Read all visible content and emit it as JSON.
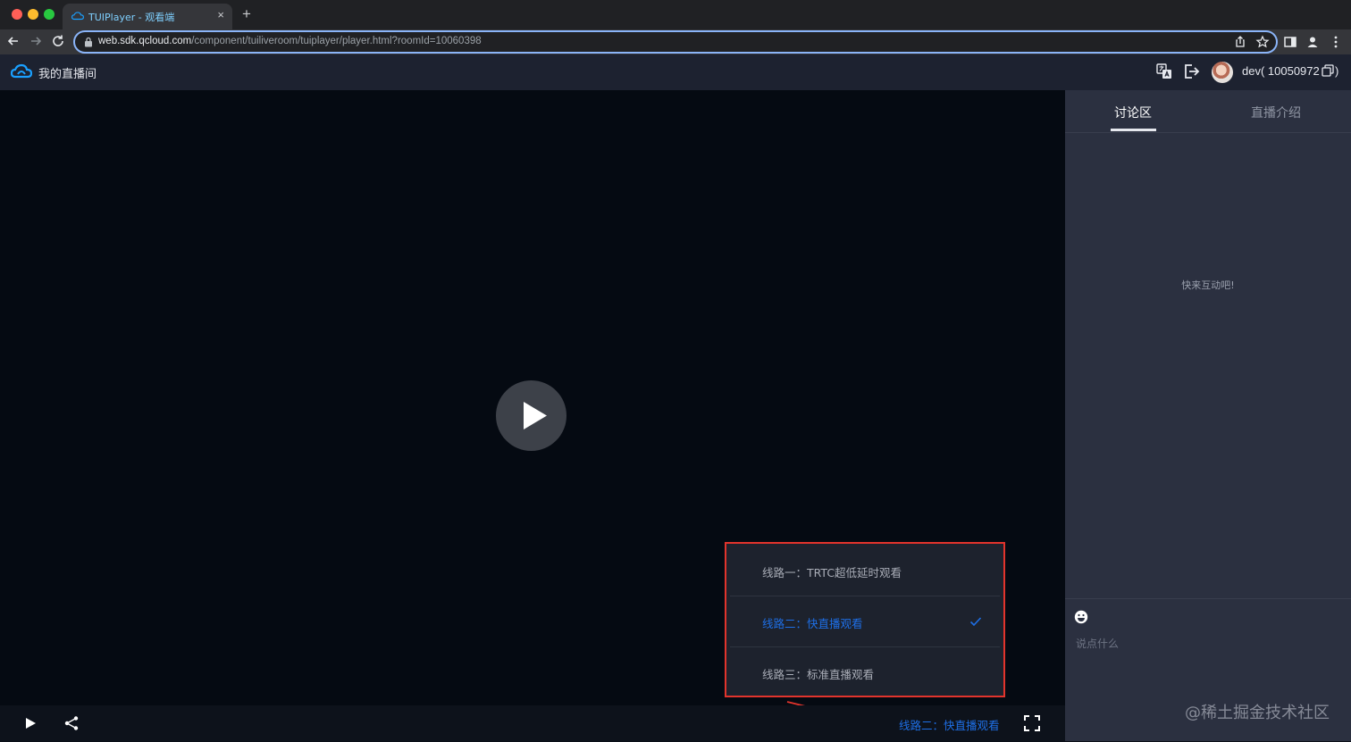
{
  "browser": {
    "tab_title": "TUIPlayer - 观看端",
    "new_tab_symbol": "+",
    "close_symbol": "×",
    "url_host": "web.sdk.qcloud.com",
    "url_path": "/component/tuiliveroom/tuiplayer/player.html?roomId=10060398"
  },
  "header": {
    "title": "我的直播间",
    "user_label": "dev( 10050972",
    "user_suffix": ")"
  },
  "player": {
    "line_options": [
      {
        "label": "线路一：TRTC超低延时观看",
        "selected": false
      },
      {
        "label": "线路二：快直播观看",
        "selected": true
      },
      {
        "label": "线路三：标准直播观看",
        "selected": false
      }
    ],
    "current_line": "线路二：快直播观看"
  },
  "side": {
    "tabs": [
      "讨论区",
      "直播介绍"
    ],
    "active_tab": 0,
    "empty_hint": "快来互动吧!",
    "input_placeholder": "说点什么"
  },
  "watermark": "@稀土掘金技术社区",
  "colors": {
    "accent": "#1e6fe6",
    "highlight_border": "#e2342c",
    "panel_bg": "#2b3040"
  }
}
